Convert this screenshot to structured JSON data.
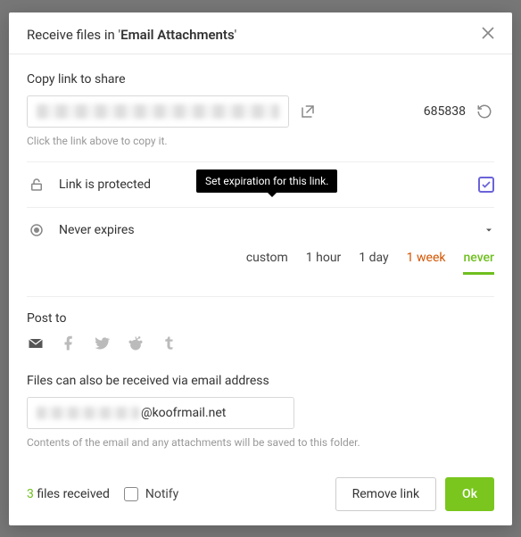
{
  "header": {
    "title_prefix": "Receive files in '",
    "folder_name": "Email Attachments",
    "title_suffix": "'"
  },
  "share": {
    "label": "Copy link to share",
    "hint": "Click the link above to copy it.",
    "counter": "685838"
  },
  "protection": {
    "label": "Link is protected",
    "tooltip": "Set expiration for this link."
  },
  "expiration": {
    "label": "Never expires",
    "options": {
      "custom": "custom",
      "hour": "1 hour",
      "day": "1 day",
      "week": "1 week",
      "never": "never"
    }
  },
  "post": {
    "label": "Post to"
  },
  "email": {
    "label": "Files can also be received via email address",
    "domain": "@koofrmail.net",
    "hint": "Contents of the email and any attachments will be saved to this folder."
  },
  "footer": {
    "files_count": "3",
    "files_text": " files received",
    "notify": "Notify",
    "remove": "Remove link",
    "ok": "Ok"
  }
}
